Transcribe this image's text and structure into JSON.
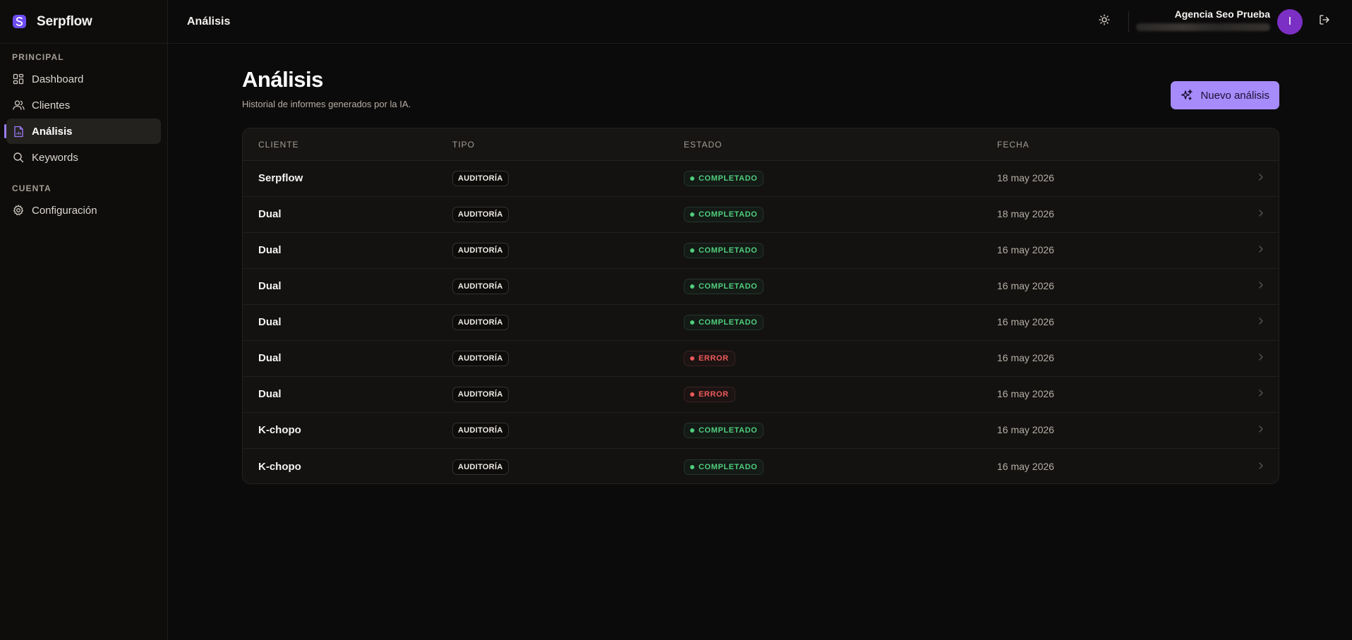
{
  "brand": {
    "name": "Serpflow",
    "accent": "#6d4cf0"
  },
  "sidebar": {
    "sections": [
      {
        "label": "PRINCIPAL",
        "items": [
          {
            "label": "Dashboard",
            "icon": "dashboard-icon",
            "active": false
          },
          {
            "label": "Clientes",
            "icon": "users-icon",
            "active": false
          },
          {
            "label": "Análisis",
            "icon": "file-chart-icon",
            "active": true
          },
          {
            "label": "Keywords",
            "icon": "search-icon",
            "active": false
          }
        ]
      },
      {
        "label": "CUENTA",
        "items": [
          {
            "label": "Configuración",
            "icon": "gear-icon",
            "active": false
          }
        ]
      }
    ]
  },
  "topbar": {
    "title": "Análisis",
    "user": {
      "name": "Agencia Seo Prueba",
      "avatar_initial": "I",
      "avatar_color": "#7c2fc4"
    }
  },
  "main": {
    "title": "Análisis",
    "subtitle": "Historial de informes generados por la IA.",
    "new_button_label": "Nuevo análisis",
    "button_color": "#a78bfa"
  },
  "table": {
    "headers": {
      "cliente": "CLIENTE",
      "tipo": "TIPO",
      "estado": "ESTADO",
      "fecha": "FECHA"
    },
    "rows": [
      {
        "cliente": "Serpflow",
        "tipo": "AUDITORÍA",
        "estado": "COMPLETADO",
        "status": "ok",
        "fecha": "18 may 2026"
      },
      {
        "cliente": "Dual",
        "tipo": "AUDITORÍA",
        "estado": "COMPLETADO",
        "status": "ok",
        "fecha": "18 may 2026"
      },
      {
        "cliente": "Dual",
        "tipo": "AUDITORÍA",
        "estado": "COMPLETADO",
        "status": "ok",
        "fecha": "16 may 2026"
      },
      {
        "cliente": "Dual",
        "tipo": "AUDITORÍA",
        "estado": "COMPLETADO",
        "status": "ok",
        "fecha": "16 may 2026"
      },
      {
        "cliente": "Dual",
        "tipo": "AUDITORÍA",
        "estado": "COMPLETADO",
        "status": "ok",
        "fecha": "16 may 2026"
      },
      {
        "cliente": "Dual",
        "tipo": "AUDITORÍA",
        "estado": "ERROR",
        "status": "error",
        "fecha": "16 may 2026"
      },
      {
        "cliente": "Dual",
        "tipo": "AUDITORÍA",
        "estado": "ERROR",
        "status": "error",
        "fecha": "16 may 2026"
      },
      {
        "cliente": "K-chopo",
        "tipo": "AUDITORÍA",
        "estado": "COMPLETADO",
        "status": "ok",
        "fecha": "16 may 2026"
      },
      {
        "cliente": "K-chopo",
        "tipo": "AUDITORÍA",
        "estado": "COMPLETADO",
        "status": "ok",
        "fecha": "16 may 2026"
      }
    ],
    "status_colors": {
      "ok": "#4fce7d",
      "error": "#ef5a5a"
    }
  }
}
